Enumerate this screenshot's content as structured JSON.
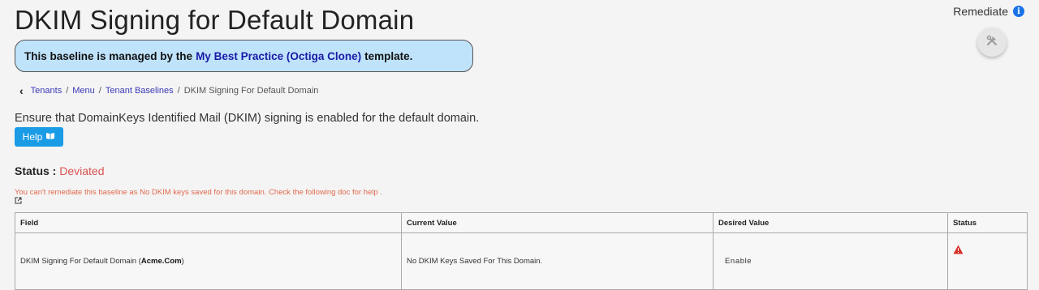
{
  "page": {
    "title": "DKIM Signing for Default Domain",
    "remediate_label": "Remediate",
    "info_icon": "info-icon",
    "remediate_icon": "tools-icon"
  },
  "banner": {
    "prefix": "This baseline is managed by the",
    "link": "My Best Practice (Octiga Clone)",
    "suffix": "template."
  },
  "breadcrumb": {
    "back_icon": "chevron-left-icon",
    "items": [
      "Tenants",
      "Menu",
      "Tenant Baselines",
      "DKIM Signing For Default Domain"
    ],
    "separator": "/"
  },
  "description": "Ensure that DomainKeys Identified Mail (DKIM) signing is enabled for the default domain.",
  "help": {
    "label": "Help",
    "icon": "book-icon"
  },
  "status": {
    "label": "Status :",
    "value": "Deviated",
    "color": "#d9534f"
  },
  "warning": "You can't remediate this baseline as No DKIM keys saved for this domain. Check the following doc for help .",
  "table": {
    "headers": [
      "Field",
      "Current Value",
      "Desired Value",
      "Status"
    ],
    "rows": [
      {
        "field_prefix": "DKIM Signing For Default Domain (",
        "field_domain": "Acme.Com",
        "field_suffix": ")",
        "current": "No DKIM Keys Saved For This Domain.",
        "desired": "Enable",
        "status_icon": "warning-icon"
      }
    ]
  },
  "colors": {
    "accent": "#1a9be6",
    "banner_bg": "#bfe3fb",
    "link": "#1a1aa6",
    "danger": "#d9312b"
  }
}
